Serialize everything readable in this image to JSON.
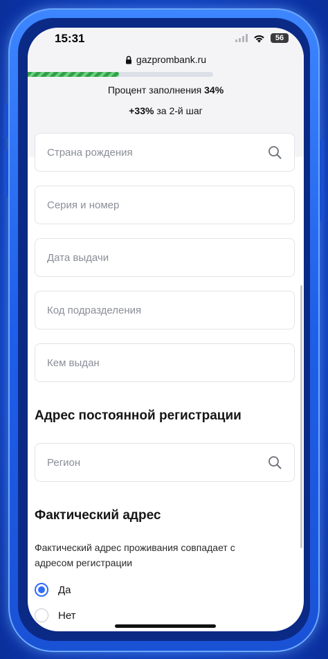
{
  "status_bar": {
    "time": "15:31",
    "battery": "56",
    "icons": [
      "signal-icon",
      "wifi-icon",
      "battery-icon"
    ]
  },
  "browser": {
    "url": "gazprombank.ru",
    "lock_icon": "lock-icon"
  },
  "progress": {
    "fill_percent": 34,
    "label_prefix": "Процент заполнения ",
    "percent_text": "34%",
    "step_gain": "+33%",
    "step_suffix": " за 2-й шаг"
  },
  "fields": [
    {
      "label": "Страна рождения",
      "icon": "search-icon"
    },
    {
      "label": "Серия и номер"
    },
    {
      "label": "Дата выдачи"
    },
    {
      "label": "Код подразделения"
    },
    {
      "label": "Кем выдан"
    }
  ],
  "registration": {
    "title": "Адрес постоянной регистрации",
    "region_label": "Регион",
    "region_icon": "search-icon"
  },
  "actual_address": {
    "title": "Фактический адрес",
    "question": "Фактический адрес проживания совпадает с адресом регистрации",
    "options": [
      {
        "label": "Да",
        "selected": true
      },
      {
        "label": "Нет",
        "selected": false
      }
    ]
  },
  "colors": {
    "accent": "#2f6df6",
    "progress": "#2fa04a",
    "phone_frame": "#1f5ee8"
  }
}
